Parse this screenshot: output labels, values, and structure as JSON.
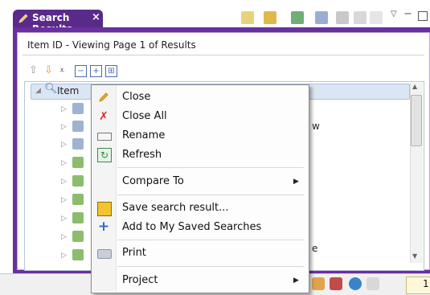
{
  "tab": {
    "title": "Search Results",
    "close": "×"
  },
  "panel": {
    "viewing_label": "Item ID - Viewing Page 1 of Results"
  },
  "tree": {
    "root_label": "Item",
    "partial_right_texts": [
      "w",
      "e"
    ]
  },
  "context_menu": {
    "items": [
      {
        "label": "Close",
        "icon": "pencil-icon"
      },
      {
        "label": "Close All",
        "icon": "close-all-icon"
      },
      {
        "label": "Rename",
        "icon": "rename-icon"
      },
      {
        "label": "Refresh",
        "icon": "refresh-icon"
      },
      {
        "label": "Compare To",
        "icon": "",
        "submenu": true
      },
      {
        "label": "Save search result...",
        "icon": "save-icon"
      },
      {
        "label": "Add to My Saved Searches",
        "icon": "plus-icon"
      },
      {
        "label": "Print",
        "icon": "print-icon"
      },
      {
        "label": "Project",
        "icon": "",
        "submenu": true
      }
    ]
  },
  "status": {
    "partial_text": "1"
  },
  "colors": {
    "panel_border": "#6a2fa0",
    "tab_bg": "#5a2a8a",
    "selection_bg": "#dbe6f5"
  }
}
